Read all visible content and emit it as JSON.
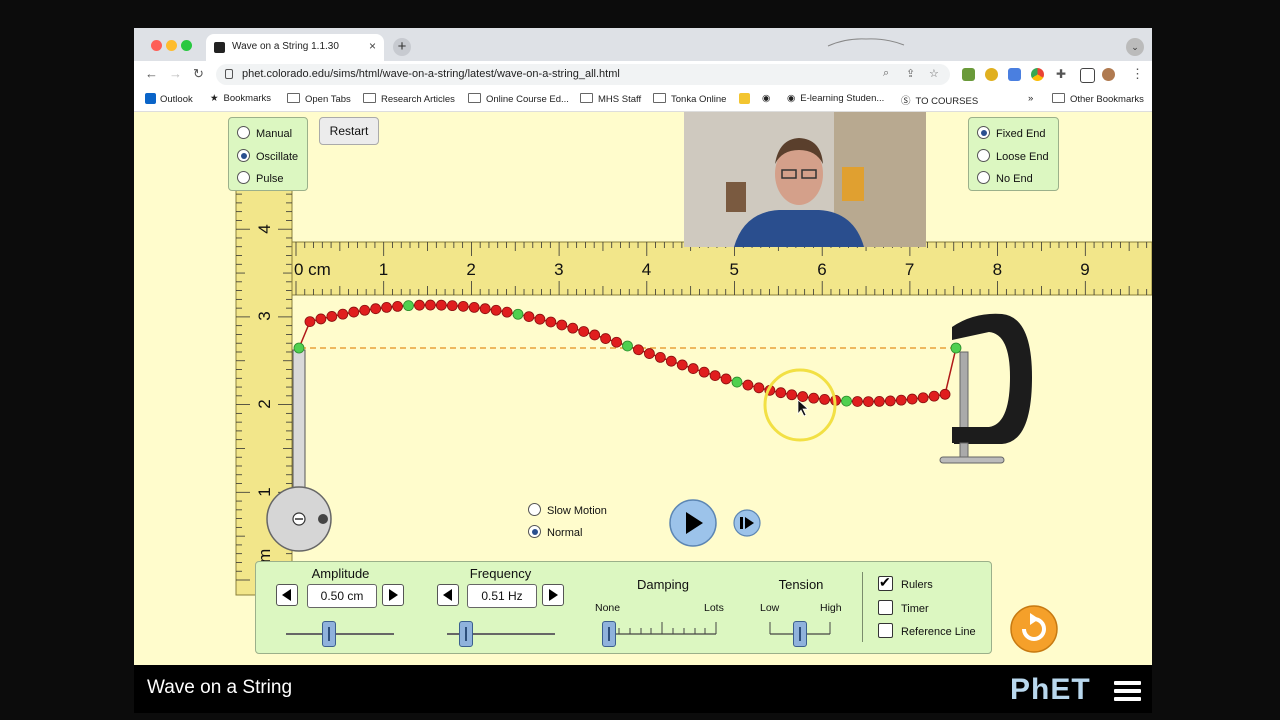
{
  "browser": {
    "tab_title": "Wave on a String 1.1.30",
    "tab_close": "×",
    "new_tab": "+",
    "url": "phet.colorado.edu/sims/html/wave-on-a-string/latest/wave-on-a-string_all.html",
    "nav": {
      "back": "←",
      "forward": "→",
      "reload": "↻"
    },
    "bookmarks": [
      {
        "label": "Outlook",
        "icon": "outlook-icon"
      },
      {
        "label": "Bookmarks",
        "icon": "star-icon"
      },
      {
        "label": "Open Tabs",
        "icon": "folder-icon"
      },
      {
        "label": "Research Articles",
        "icon": "folder-icon"
      },
      {
        "label": "Online Course Ed...",
        "icon": "folder-icon"
      },
      {
        "label": "MHS Staff",
        "icon": "folder-icon"
      },
      {
        "label": "Tonka Online",
        "icon": "folder-icon"
      },
      {
        "label": "E-learning Studen...",
        "icon": "globe-icon"
      },
      {
        "label": "TO COURSES",
        "icon": "site-icon"
      }
    ],
    "bookmarks_more": "»",
    "other_bookmarks": "Other Bookmarks"
  },
  "sim": {
    "mode_options": [
      "Manual",
      "Oscillate",
      "Pulse"
    ],
    "mode_selected": "Oscillate",
    "restart_label": "Restart",
    "end_options": [
      "Fixed End",
      "Loose End",
      "No End"
    ],
    "end_selected": "Fixed End",
    "ruler_h_labels": [
      "0 cm",
      "1",
      "2",
      "3",
      "4",
      "5",
      "6",
      "7",
      "8",
      "9"
    ],
    "ruler_v_labels": [
      "4",
      "3",
      "2",
      "1",
      "cm"
    ],
    "speed_options": [
      "Slow Motion",
      "Normal"
    ],
    "speed_selected": "Normal",
    "amplitude": {
      "title": "Amplitude",
      "value": "0.50 cm"
    },
    "frequency": {
      "title": "Frequency",
      "value": "0.51 Hz"
    },
    "damping": {
      "title": "Damping",
      "min_label": "None",
      "max_label": "Lots",
      "level": 0
    },
    "tension": {
      "title": "Tension",
      "min_label": "Low",
      "max_label": "High",
      "level": 0.5
    },
    "checks": [
      {
        "label": "Rulers",
        "checked": true
      },
      {
        "label": "Timer",
        "checked": false
      },
      {
        "label": "Reference Line",
        "checked": false
      }
    ],
    "footer_title": "Wave on a String",
    "brand": "PhET"
  },
  "colors": {
    "background": "#fffccc",
    "panel": "#dcf7c1",
    "bead_red": "#e01e1e",
    "bead_green": "#4fd04f",
    "ruler": "#f2e68a"
  }
}
